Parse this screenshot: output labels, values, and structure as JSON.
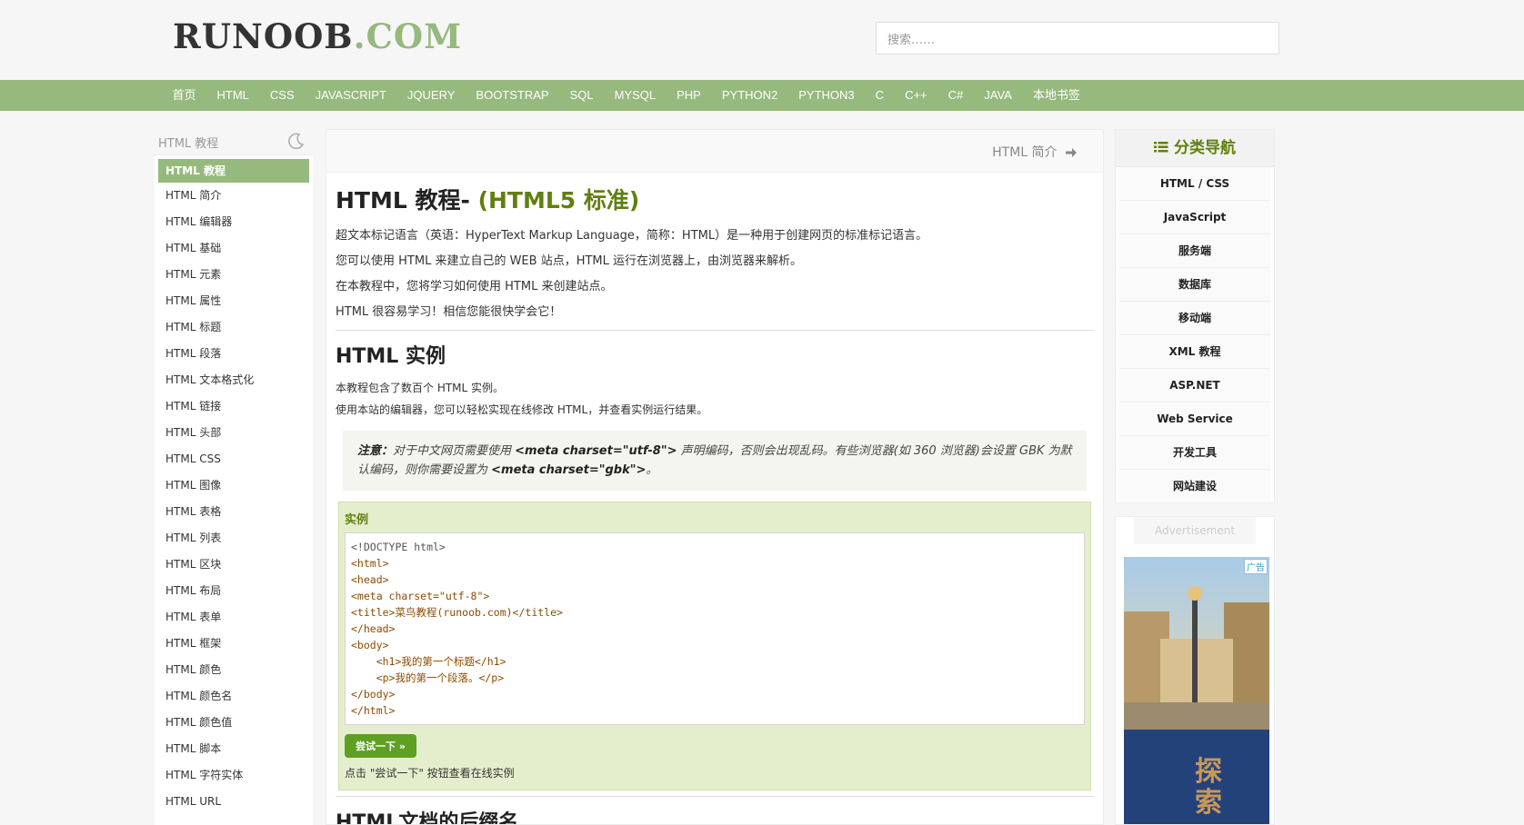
{
  "header": {
    "logo_part1": "RUNOOB",
    "logo_part2": ".COM",
    "search_placeholder": "搜索……"
  },
  "nav": {
    "items": [
      "首页",
      "HTML",
      "CSS",
      "JAVASCRIPT",
      "JQUERY",
      "BOOTSTRAP",
      "SQL",
      "MYSQL",
      "PHP",
      "PYTHON2",
      "PYTHON3",
      "C",
      "C++",
      "C#",
      "JAVA",
      "本地书签"
    ]
  },
  "left_sidebar": {
    "title": "HTML 教程",
    "items": [
      "HTML 教程",
      "HTML 简介",
      "HTML 编辑器",
      "HTML 基础",
      "HTML 元素",
      "HTML 属性",
      "HTML 标题",
      "HTML 段落",
      "HTML 文本格式化",
      "HTML 链接",
      "HTML 头部",
      "HTML CSS",
      "HTML 图像",
      "HTML 表格",
      "HTML 列表",
      "HTML 区块",
      "HTML 布局",
      "HTML 表单",
      "HTML 框架",
      "HTML 颜色",
      "HTML 颜色名",
      "HTML 颜色值",
      "HTML 脚本",
      "HTML 字符实体",
      "HTML URL"
    ]
  },
  "main": {
    "next_link": "HTML 简介",
    "title": "HTML 教程- ",
    "title_sub": "(HTML5 标准)",
    "intro": [
      "超文本标记语言（英语：HyperText Markup Language，简称：HTML）是一种用于创建网页的标准标记语言。",
      "您可以使用 HTML 来建立自己的 WEB 站点，HTML 运行在浏览器上，由浏览器来解析。",
      "在本教程中，您将学习如何使用 HTML 来创建站点。",
      "HTML 很容易学习！相信您能很快学会它！"
    ],
    "section1_title": "HTML 实例",
    "section1_text": [
      "本教程包含了数百个 HTML 实例。",
      "使用本站的编辑器，您可以轻松实现在线修改 HTML，并查看实例运行结果。"
    ],
    "note_label": "注意：",
    "note_text1": "对于中文网页需要使用 ",
    "note_code1": "<meta charset=\"utf-8\">",
    "note_text2": " 声明编码，否则会出现乱码。有些浏览器(如 360 浏览器)会设置 GBK 为默认编码，则你需要设置为 ",
    "note_code2": "<meta charset=\"gbk\">",
    "note_text3": "。",
    "example_title": "实例",
    "code_lines": [
      "<!DOCTYPE html>",
      "<html>",
      "<head>",
      "<meta charset=\"utf-8\">",
      "<title>菜鸟教程(runoob.com)</title>",
      "</head>",
      "<body>",
      "    <h1>我的第一个标题</h1>",
      "    <p>我的第一个段落。</p>",
      "</body>",
      "</html>"
    ],
    "try_button": "尝试一下 »",
    "try_note": "点击 \"尝试一下\" 按钮查看在线实例",
    "section2_title": "HTML文档的后缀名"
  },
  "right_sidebar": {
    "title": "分类导航",
    "items": [
      "HTML / CSS",
      "JavaScript",
      "服务端",
      "数据库",
      "移动端",
      "XML 教程",
      "ASP.NET",
      "Web Service",
      "开发工具",
      "网站建设"
    ]
  },
  "ad": {
    "label": "Advertisement",
    "badge": "广告",
    "text": "探索"
  },
  "colors": {
    "accent": "#96b97d",
    "dark_green": "#617f10",
    "try_button": "#5fa022"
  }
}
